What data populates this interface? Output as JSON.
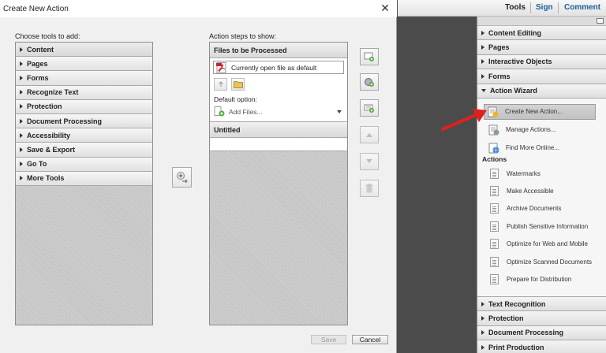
{
  "dialog": {
    "title": "Create New Action",
    "tools_label": "Choose tools to add:",
    "steps_label": "Action steps to show:",
    "tools": [
      "Content",
      "Pages",
      "Forms",
      "Recognize Text",
      "Protection",
      "Document Processing",
      "Accessibility",
      "Save & Export",
      "Go To",
      "More Tools"
    ],
    "files_header": "Files to be Processed",
    "file_source": "Currently open file as default",
    "default_option_label": "Default option:",
    "add_files": "Add Files...",
    "untitled": "Untitled",
    "save_label": "Save",
    "cancel_label": "Cancel"
  },
  "topbar": {
    "tools": "Tools",
    "sign": "Sign",
    "comment": "Comment"
  },
  "panel": {
    "sections_top": [
      "Content Editing",
      "Pages",
      "Interactive Objects",
      "Forms"
    ],
    "action_wizard": "Action Wizard",
    "wizard_items": [
      "Create New Action...",
      "Manage Actions...",
      "Find More Online..."
    ],
    "actions_label": "Actions",
    "actions": [
      "Watermarks",
      "Make Accessible",
      "Archive Documents",
      "Publish Sensitive Information",
      "Optimize for Web and Mobile",
      "Optimize Scanned Documents",
      "Prepare for Distribution"
    ],
    "sections_bottom": [
      "Text Recognition",
      "Protection",
      "Document Processing",
      "Print Production"
    ]
  },
  "colors": {
    "link_blue": "#1c5c9c",
    "arrow_red": "#e02020"
  }
}
